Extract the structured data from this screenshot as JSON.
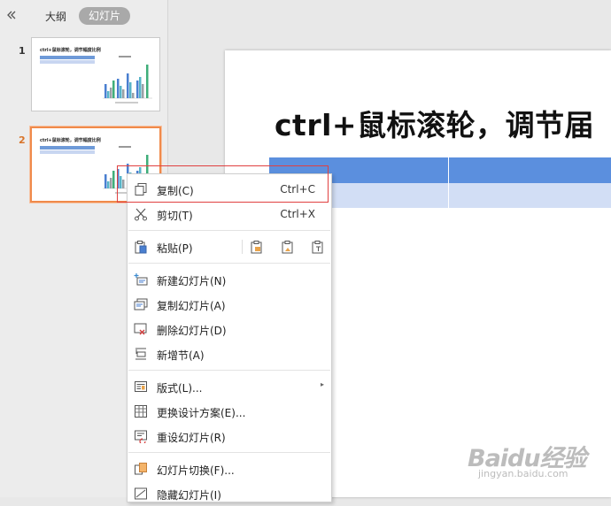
{
  "sidebar": {
    "collapse_icon": "double-chevron-left-icon",
    "tabs": [
      {
        "label": "大纲",
        "active": false
      },
      {
        "label": "幻灯片",
        "active": true
      }
    ],
    "slides": [
      {
        "number": "1",
        "title": "ctrl+鼠标滚轮，调节幅度比例",
        "active": false
      },
      {
        "number": "2",
        "title": "ctrl+鼠标滚轮，调节幅度比例",
        "active": true
      }
    ]
  },
  "slide": {
    "title": "ctrl+鼠标滚轮，调节届",
    "table_header_color": "#5b8fde",
    "table_row_color": "#d2def5"
  },
  "context_menu": {
    "items": [
      {
        "label": "复制(C)",
        "shortcut": "Ctrl+C",
        "icon": "copy-icon"
      },
      {
        "label": "剪切(T)",
        "shortcut": "Ctrl+X",
        "icon": "scissors-icon"
      },
      {
        "label": "粘贴(P)",
        "icon": "paste-icon",
        "paste_options": [
          "paste-keep-format-icon",
          "paste-as-picture-icon",
          "paste-text-only-icon"
        ]
      },
      {
        "label": "新建幻灯片(N)",
        "icon": "new-slide-icon"
      },
      {
        "label": "复制幻灯片(A)",
        "icon": "duplicate-slide-icon"
      },
      {
        "label": "删除幻灯片(D)",
        "icon": "delete-slide-icon"
      },
      {
        "label": "新增节(A)",
        "icon": "add-section-icon"
      },
      {
        "label": "版式(L)...",
        "icon": "layout-icon",
        "submenu": true
      },
      {
        "label": "更换设计方案(E)...",
        "icon": "design-scheme-icon"
      },
      {
        "label": "重设幻灯片(R)",
        "icon": "reset-slide-icon"
      },
      {
        "label": "幻灯片切换(F)...",
        "icon": "slide-transition-icon"
      },
      {
        "label": "隐藏幻灯片(I)",
        "icon": "hide-slide-icon"
      }
    ]
  },
  "thumbnail_chart": {
    "series_colors": [
      "#4a7fd0",
      "#58b4c8",
      "#9aa0a6",
      "#3fae7a"
    ]
  },
  "watermark": {
    "text": "Baidu经验",
    "url": "jingyan.baidu.com"
  }
}
